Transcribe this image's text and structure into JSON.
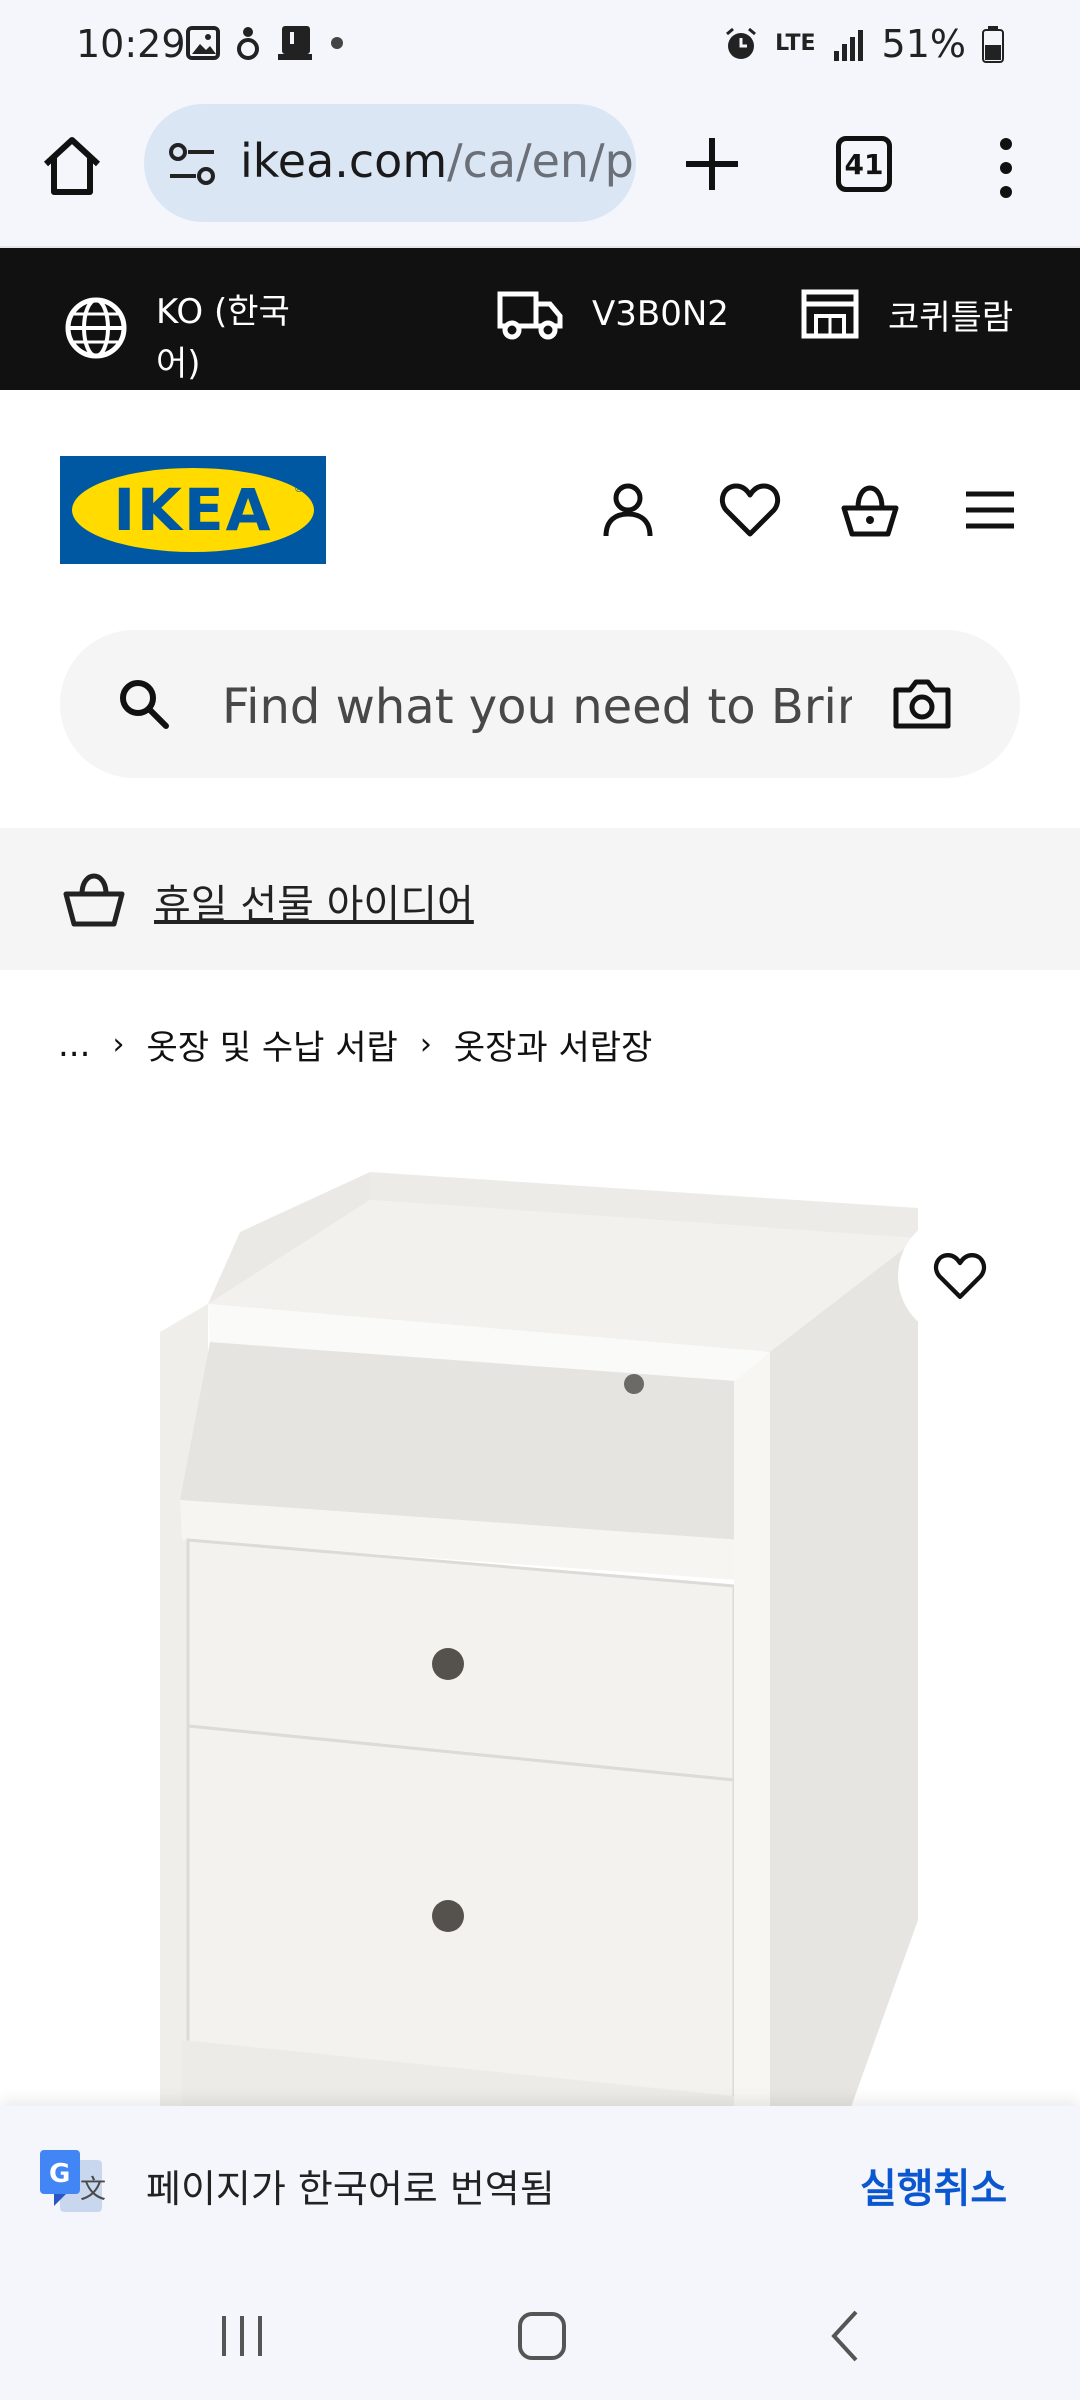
{
  "status_bar": {
    "time": "10:29",
    "network": "LTE",
    "battery": "51%"
  },
  "browser": {
    "url_domain": "ikea.com",
    "url_path": "/ca/en/p/",
    "tab_count": "41"
  },
  "top_bar": {
    "language": "KO (한국어)",
    "postal_code": "V3B0N2",
    "store": "코퀴틀람"
  },
  "search": {
    "placeholder": "Find what you need to Bring"
  },
  "promo": {
    "label": "휴일 선물 아이디어"
  },
  "breadcrumb": {
    "ellipsis": "...",
    "items": [
      "옷장 및 수납 서랍",
      "옷장과 서랍장"
    ]
  },
  "translate": {
    "message": "페이지가 한국어로 번역됨",
    "undo_label": "실행취소"
  },
  "colors": {
    "ikea_blue": "#0058a3",
    "ikea_yellow": "#ffdb00",
    "top_bar": "#111111",
    "accent_link": "#0b57d0"
  },
  "icons": [
    "home-icon",
    "site-settings-icon",
    "plus-icon",
    "more-vert-icon",
    "globe-icon",
    "truck-icon",
    "store-icon",
    "person-icon",
    "heart-icon",
    "basket-icon",
    "hamburger-icon",
    "search-icon",
    "camera-icon",
    "translate-icon"
  ]
}
